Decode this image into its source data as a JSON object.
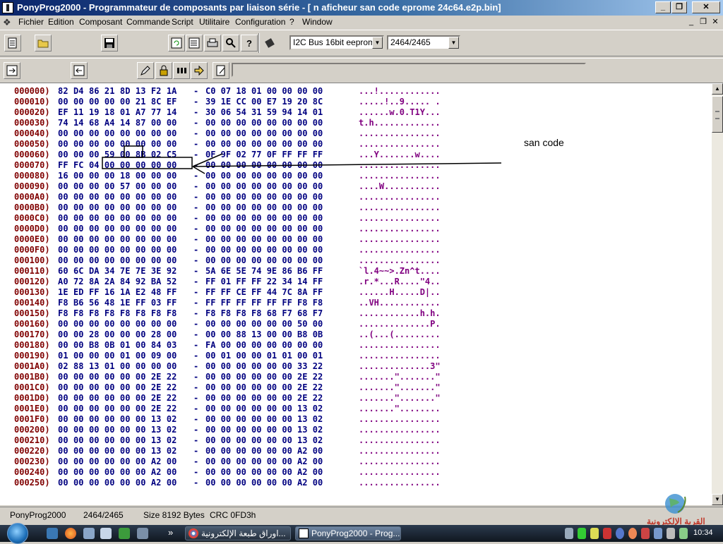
{
  "window": {
    "title": "PonyProg2000 - Programmateur de composants par liaison série - [ n aficheur san code eprome 24c64.e2p.bin]",
    "minimize": "_",
    "restore": "❐",
    "close": "✕"
  },
  "menu": {
    "items": [
      "Fichier",
      "Edition",
      "Composant",
      "Commande",
      "Script",
      "Utilitaire",
      "Configuration",
      "?",
      "Window"
    ],
    "mdi_minimize": "_",
    "mdi_restore": "❐",
    "mdi_close": "✕"
  },
  "toolbar": {
    "device_family": "I2C Bus 16bit eeprom",
    "device_type": "2464/2465",
    "icons": [
      "open-file-icon",
      "open-folder-icon",
      "save-icon",
      "reload-icon",
      "write-icon",
      "print-icon",
      "setup-icon",
      "help-icon",
      "chip-icon",
      "read-icon",
      "write-all-icon",
      "edit-icon",
      "lock-icon",
      "grid-icon",
      "arrow-right-icon",
      "script-icon"
    ]
  },
  "hex": {
    "rows": [
      {
        "addr": "000000)",
        "b1": "82 D4 86 21 8D 13 F2 1A",
        "b2": "C0 07 18 01 00 00 00 00",
        "ascii": "...!............"
      },
      {
        "addr": "000010)",
        "b1": "00 00 00 00 00 21 8C EF",
        "b2": "39 1E CC 00 E7 19 20 8C",
        "ascii": ".....!..9..... ."
      },
      {
        "addr": "000020)",
        "b1": "EF 11 19 18 01 A7 77 14",
        "b2": "30 06 54 31 59 94 14 01",
        "ascii": "......w.0.T1Y..."
      },
      {
        "addr": "000030)",
        "b1": "74 14 68 A4 14 87 00 00",
        "b2": "00 00 00 00 00 00 00 00",
        "ascii": "t.h............."
      },
      {
        "addr": "000040)",
        "b1": "00 00 00 00 00 00 00 00",
        "b2": "00 00 00 00 00 00 00 00",
        "ascii": "................"
      },
      {
        "addr": "000050)",
        "b1": "00 00 00 00 00 00 00 00",
        "b2": "00 00 00 00 00 00 00 00",
        "ascii": "................"
      },
      {
        "addr": "000060)",
        "b1": "00 00 00 59 00 8B 02 C5",
        "b2": "0F 9F 02 77 0F FF FF FF",
        "ascii": "...Y.......w...."
      },
      {
        "addr": "000070)",
        "b1": "FF FC 04 00 00 00 00 00",
        "b2": "00 00 00 00 00 00 00 00",
        "ascii": "................"
      },
      {
        "addr": "000080)",
        "b1": "16 00 00 00 18 00 00 00",
        "b2": "00 00 00 00 00 00 00 00",
        "ascii": "................"
      },
      {
        "addr": "000090)",
        "b1": "00 00 00 00 57 00 00 00",
        "b2": "00 00 00 00 00 00 00 00",
        "ascii": "....W..........."
      },
      {
        "addr": "0000A0)",
        "b1": "00 00 00 00 00 00 00 00",
        "b2": "00 00 00 00 00 00 00 00",
        "ascii": "................"
      },
      {
        "addr": "0000B0)",
        "b1": "00 00 00 00 00 00 00 00",
        "b2": "00 00 00 00 00 00 00 00",
        "ascii": "................"
      },
      {
        "addr": "0000C0)",
        "b1": "00 00 00 00 00 00 00 00",
        "b2": "00 00 00 00 00 00 00 00",
        "ascii": "................"
      },
      {
        "addr": "0000D0)",
        "b1": "00 00 00 00 00 00 00 00",
        "b2": "00 00 00 00 00 00 00 00",
        "ascii": "................"
      },
      {
        "addr": "0000E0)",
        "b1": "00 00 00 00 00 00 00 00",
        "b2": "00 00 00 00 00 00 00 00",
        "ascii": "................"
      },
      {
        "addr": "0000F0)",
        "b1": "00 00 00 00 00 00 00 00",
        "b2": "00 00 00 00 00 00 00 00",
        "ascii": "................"
      },
      {
        "addr": "000100)",
        "b1": "00 00 00 00 00 00 00 00",
        "b2": "00 00 00 00 00 00 00 00",
        "ascii": "................"
      },
      {
        "addr": "000110)",
        "b1": "60 6C DA 34 7E 7E 3E 92",
        "b2": "5A 6E 5E 74 9E 86 B6 FF",
        "ascii": "`l.4~~>.Zn^t...."
      },
      {
        "addr": "000120)",
        "b1": "A0 72 8A 2A 84 92 BA 52",
        "b2": "FF 01 FF FF 22 34 14 FF",
        "ascii": ".r.*...R....\"4.."
      },
      {
        "addr": "000130)",
        "b1": "1E ED FF 16 1A E2 48 FF",
        "b2": "FF FF CE FF 44 7C 8A FF",
        "ascii": "......H.....D|.."
      },
      {
        "addr": "000140)",
        "b1": "F8 B6 56 48 1E FF 03 FF",
        "b2": "FF FF FF FF FF FF F8 F8",
        "ascii": "..VH............"
      },
      {
        "addr": "000150)",
        "b1": "F8 F8 F8 F8 F8 F8 F8 F8",
        "b2": "F8 F8 F8 F8 68 F7 68 F7",
        "ascii": "............h.h."
      },
      {
        "addr": "000160)",
        "b1": "00 00 00 00 00 00 00 00",
        "b2": "00 00 00 00 00 00 50 00",
        "ascii": "..............P."
      },
      {
        "addr": "000170)",
        "b1": "00 00 28 00 00 00 28 00",
        "b2": "00 00 88 13 00 00 B8 0B",
        "ascii": "..(...(........."
      },
      {
        "addr": "000180)",
        "b1": "00 00 B8 0B 01 00 84 03",
        "b2": "FA 00 00 00 00 00 00 00",
        "ascii": "................"
      },
      {
        "addr": "000190)",
        "b1": "01 00 00 00 01 00 09 00",
        "b2": "00 01 00 00 01 01 00 01",
        "ascii": "................"
      },
      {
        "addr": "0001A0)",
        "b1": "02 88 13 01 00 00 00 00",
        "b2": "00 00 00 00 00 00 33 22",
        "ascii": "..............3\""
      },
      {
        "addr": "0001B0)",
        "b1": "00 00 00 00 00 00 2E 22",
        "b2": "00 00 00 00 00 00 2E 22",
        "ascii": ".......\".......\""
      },
      {
        "addr": "0001C0)",
        "b1": "00 00 00 00 00 00 2E 22",
        "b2": "00 00 00 00 00 00 2E 22",
        "ascii": ".......\".......\""
      },
      {
        "addr": "0001D0)",
        "b1": "00 00 00 00 00 00 2E 22",
        "b2": "00 00 00 00 00 00 2E 22",
        "ascii": ".......\".......\""
      },
      {
        "addr": "0001E0)",
        "b1": "00 00 00 00 00 00 2E 22",
        "b2": "00 00 00 00 00 00 13 02",
        "ascii": ".......\"........"
      },
      {
        "addr": "0001F0)",
        "b1": "00 00 00 00 00 00 13 02",
        "b2": "00 00 00 00 00 00 13 02",
        "ascii": "................"
      },
      {
        "addr": "000200)",
        "b1": "00 00 00 00 00 00 13 02",
        "b2": "00 00 00 00 00 00 13 02",
        "ascii": "................"
      },
      {
        "addr": "000210)",
        "b1": "00 00 00 00 00 00 13 02",
        "b2": "00 00 00 00 00 00 13 02",
        "ascii": "................"
      },
      {
        "addr": "000220)",
        "b1": "00 00 00 00 00 00 13 02",
        "b2": "00 00 00 00 00 00 A2 00",
        "ascii": "................"
      },
      {
        "addr": "000230)",
        "b1": "00 00 00 00 00 00 A2 00",
        "b2": "00 00 00 00 00 00 A2 00",
        "ascii": "................"
      },
      {
        "addr": "000240)",
        "b1": "00 00 00 00 00 00 A2 00",
        "b2": "00 00 00 00 00 00 A2 00",
        "ascii": "................"
      },
      {
        "addr": "000250)",
        "b1": "00 00 00 00 00 00 A2 00",
        "b2": "00 00 00 00 00 00 A2 00",
        "ascii": "................"
      }
    ]
  },
  "annotation": {
    "label": "san code"
  },
  "status": {
    "app": "PonyProg2000",
    "device": "2464/2465",
    "size": "Size  8192 Bytes",
    "crc": "CRC  0FD3h"
  },
  "taskbar": {
    "task1": "اوراق طبعة الإلكترونية...",
    "task2": "PonyProg2000 - Prog...",
    "overflow": "»",
    "clock": "10:34"
  },
  "watermark": {
    "text": "القرية الإلكترونية"
  },
  "colors": {
    "address": "#800000",
    "bytes": "#000080",
    "ascii": "#800080",
    "titlebar": "#0a246a"
  }
}
